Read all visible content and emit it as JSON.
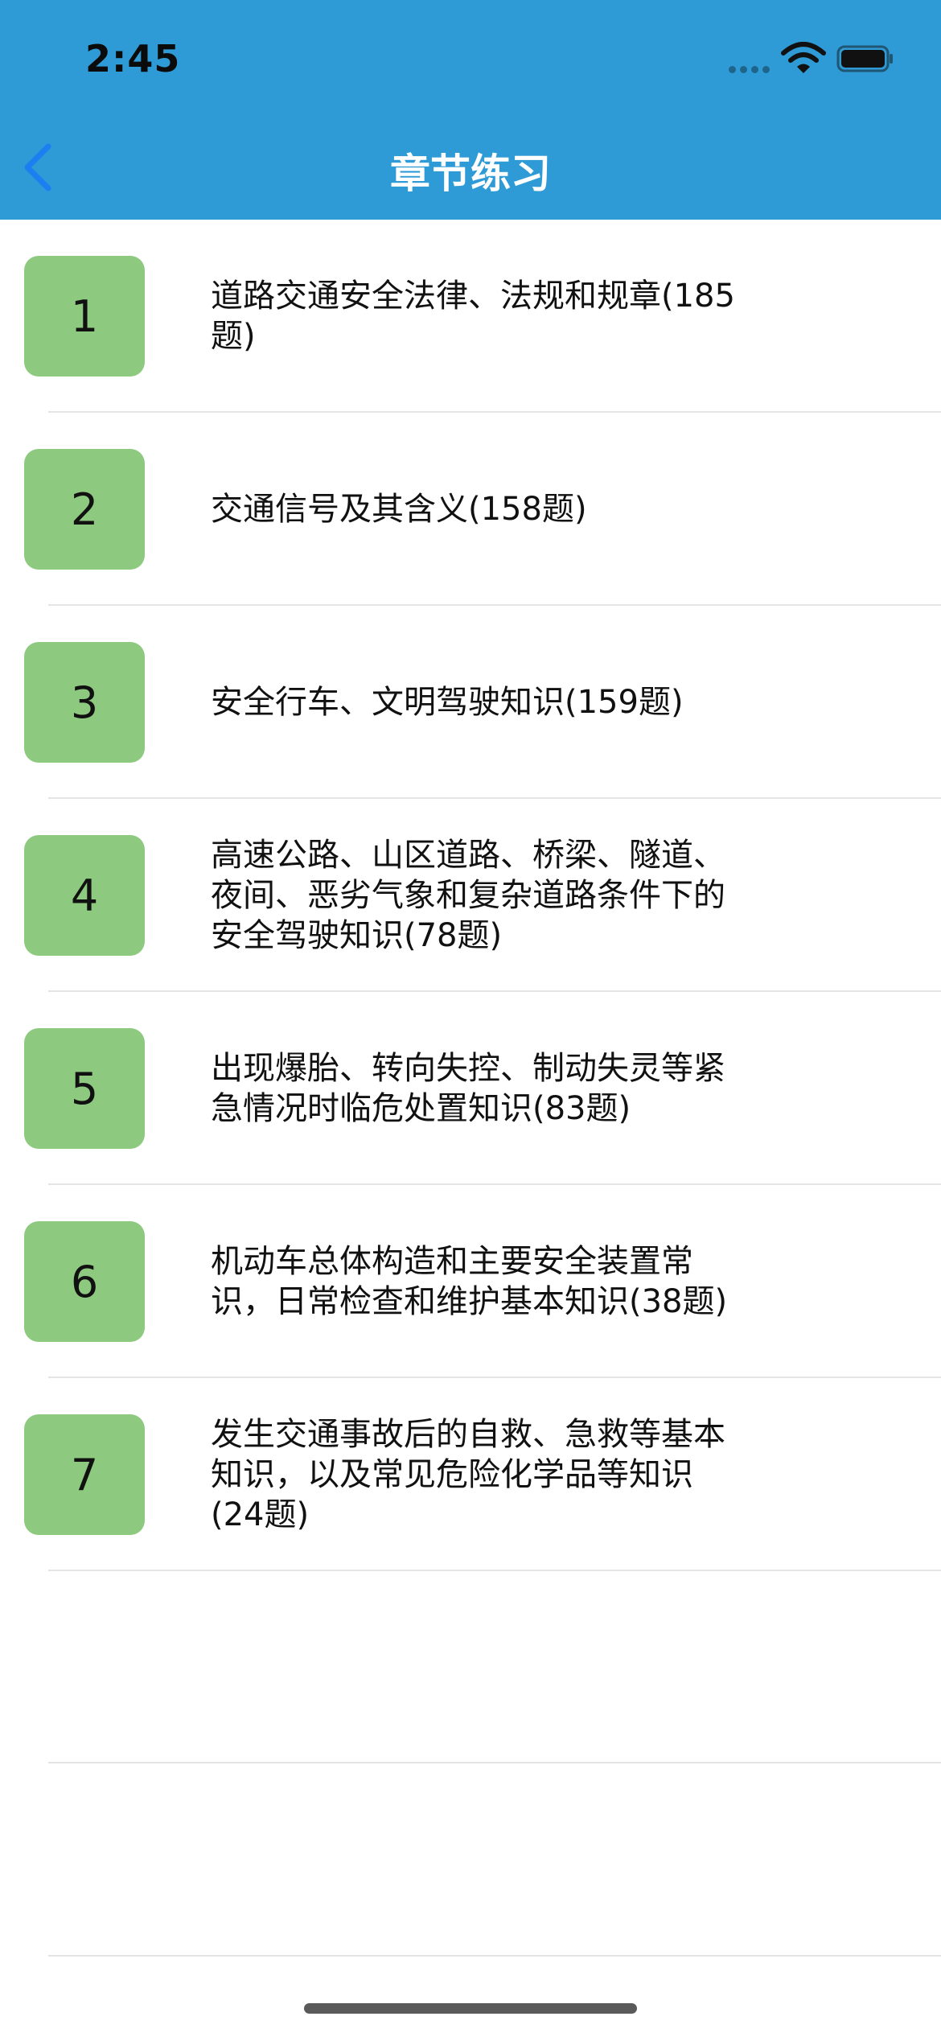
{
  "status_bar": {
    "time": "2:45"
  },
  "nav": {
    "title": "章节练习",
    "back_icon": "chevron-left-icon"
  },
  "chapters": [
    {
      "number": "1",
      "title": "道路交通安全法律、法规和规章(185题)"
    },
    {
      "number": "2",
      "title": "交通信号及其含义(158题)"
    },
    {
      "number": "3",
      "title": "安全行车、文明驾驶知识(159题)"
    },
    {
      "number": "4",
      "title": "高速公路、山区道路、桥梁、隧道、夜间、恶劣气象和复杂道路条件下的安全驾驶知识(78题)"
    },
    {
      "number": "5",
      "title": "出现爆胎、转向失控、制动失灵等紧急情况时临危处置知识(83题)"
    },
    {
      "number": "6",
      "title": "机动车总体构造和主要安全装置常识，日常检查和维护基本知识(38题)"
    },
    {
      "number": "7",
      "title": "发生交通事故后的自救、急救等基本知识，以及常见危险化学品等知识(24题)"
    }
  ],
  "colors": {
    "nav_background": "#2f9bd6",
    "badge_background": "#8dc97e",
    "back_arrow": "#1a7ff0"
  }
}
